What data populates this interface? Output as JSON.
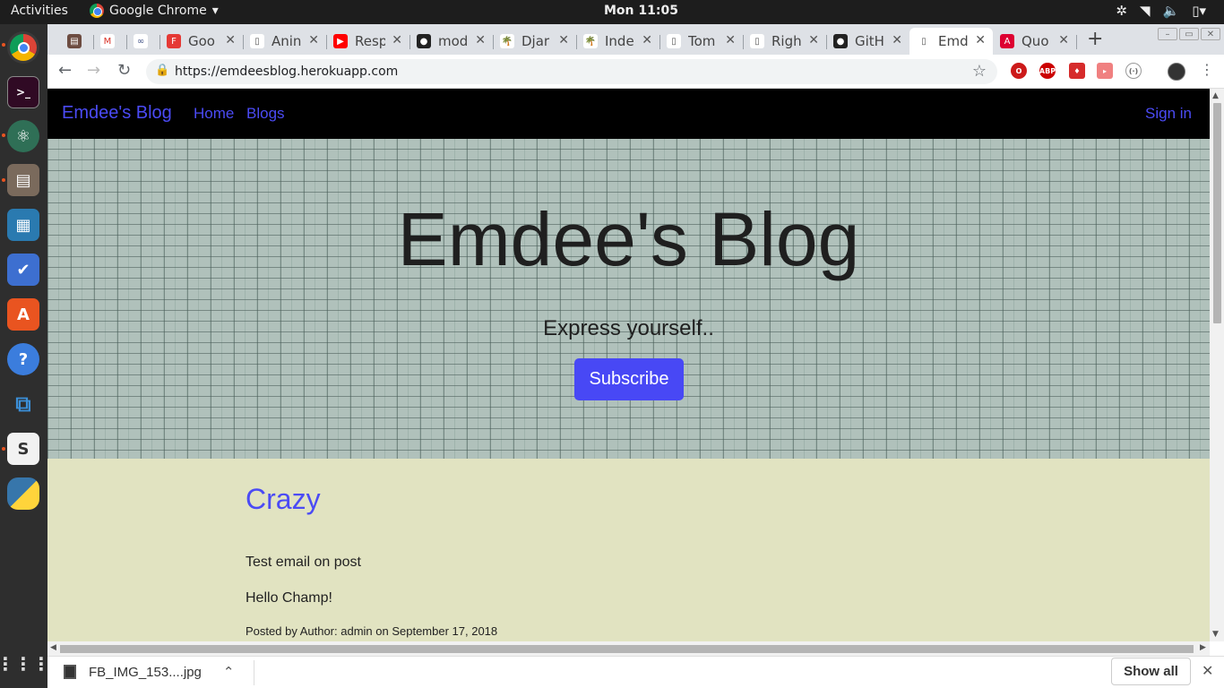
{
  "system": {
    "activities": "Activities",
    "app_name": "Google Chrome",
    "clock": "Mon 11:05"
  },
  "dock": {
    "items": [
      "chrome",
      "terminal",
      "atom",
      "files",
      "libreoffice-writer",
      "todo",
      "software-center",
      "help",
      "vscode",
      "slack",
      "python"
    ]
  },
  "tabs": [
    {
      "title": "",
      "icon": "bookmark-icon"
    },
    {
      "title": "",
      "icon": "gmail-icon"
    },
    {
      "title": "",
      "icon": "link-icon"
    },
    {
      "title": "Goo",
      "icon": "firebase-icon"
    },
    {
      "title": "Anin",
      "icon": "page-icon"
    },
    {
      "title": "Resp",
      "icon": "youtube-icon"
    },
    {
      "title": "mod",
      "icon": "github-icon"
    },
    {
      "title": "Djar",
      "icon": "palm-icon"
    },
    {
      "title": "Inde",
      "icon": "palm-icon"
    },
    {
      "title": "Tom",
      "icon": "page-icon"
    },
    {
      "title": "Righ",
      "icon": "page-icon"
    },
    {
      "title": "GitH",
      "icon": "github-icon"
    },
    {
      "title": "Emd",
      "icon": "page-icon",
      "active": true
    },
    {
      "title": "Quo",
      "icon": "angular-icon"
    }
  ],
  "omnibox": {
    "url": "https://emdeesblog.herokuapp.com"
  },
  "site": {
    "brand": "Emdee's Blog",
    "nav": [
      "Home",
      "Blogs"
    ],
    "sign_in": "Sign in",
    "hero": {
      "title": "Emdee's Blog",
      "subtitle": "Express yourself..",
      "button": "Subscribe"
    },
    "post": {
      "title": "Crazy",
      "subtitle": "Test email on post",
      "body": "Hello Champ!",
      "meta": "Posted by Author: admin on September 17, 2018"
    }
  },
  "downloads": {
    "file": "FB_IMG_153....jpg",
    "show_all": "Show all"
  },
  "colors": {
    "nav_bg": "#000000",
    "link": "#4b4bf5",
    "button": "#4848f5",
    "content_bg": "#e1e3c1"
  }
}
